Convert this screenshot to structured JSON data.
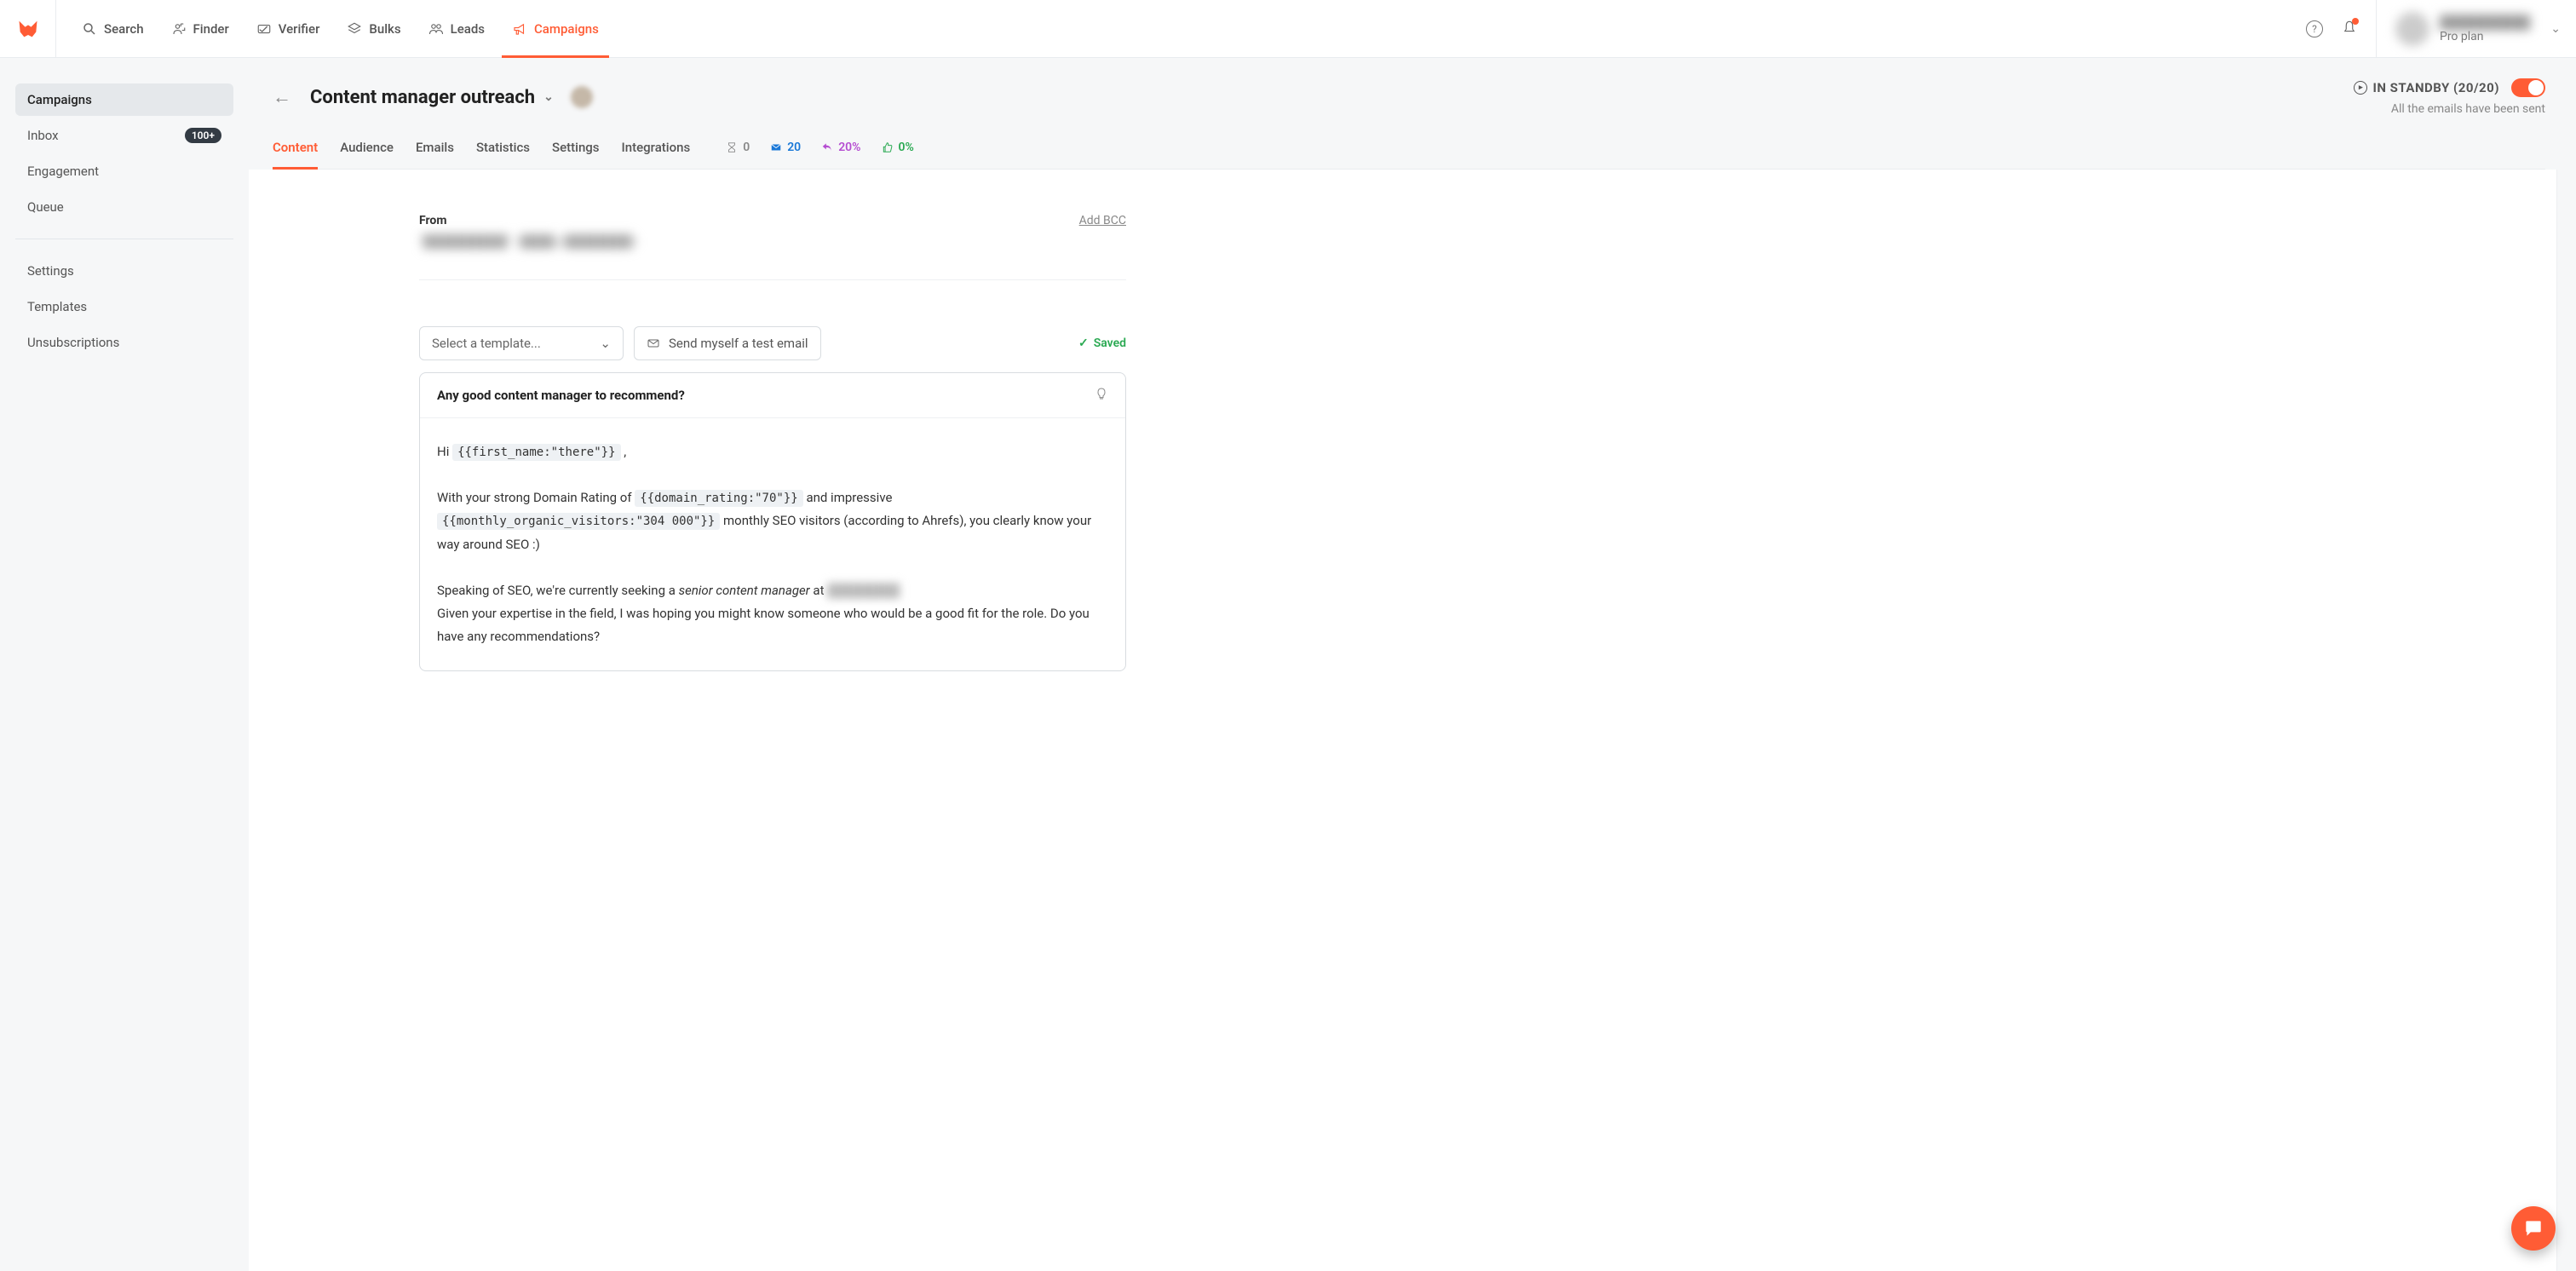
{
  "topnav": {
    "items": [
      {
        "label": "Search"
      },
      {
        "label": "Finder"
      },
      {
        "label": "Verifier"
      },
      {
        "label": "Bulks"
      },
      {
        "label": "Leads"
      },
      {
        "label": "Campaigns"
      }
    ],
    "account": {
      "name": "██████████",
      "plan": "Pro plan"
    }
  },
  "sidebar": {
    "primary": [
      {
        "label": "Campaigns",
        "active": true
      },
      {
        "label": "Inbox",
        "badge": "100+"
      },
      {
        "label": "Engagement"
      },
      {
        "label": "Queue"
      }
    ],
    "secondary": [
      {
        "label": "Settings"
      },
      {
        "label": "Templates"
      },
      {
        "label": "Unsubscriptions"
      }
    ]
  },
  "header": {
    "title": "Content manager outreach",
    "standby": "IN STANDBY (20/20)",
    "standby_sub": "All the emails have been sent"
  },
  "tabs": [
    "Content",
    "Audience",
    "Emails",
    "Statistics",
    "Settings",
    "Integrations"
  ],
  "stats": {
    "pending": "0",
    "sent": "20",
    "replies": "20%",
    "positive": "0%"
  },
  "from": {
    "label": "From",
    "value": "\"██████████\" <████@████████>",
    "add_bcc": "Add BCC"
  },
  "template": {
    "select_placeholder": "Select a template...",
    "test_email": "Send myself a test email",
    "saved": "Saved"
  },
  "email": {
    "subject": "Any good content manager to recommend?",
    "body": {
      "hi": "Hi ",
      "token_first": "{{first_name:\"there\"}}",
      "comma": " ,",
      "p2a": "With your strong Domain Rating of ",
      "token_dr": "{{domain_rating:\"70\"}}",
      "p2b": " and impressive ",
      "token_mv": "{{monthly_organic_visitors:\"304 000\"}}",
      "p2c": " monthly SEO visitors (according to Ahrefs), you clearly know your way around SEO :)",
      "p3a": "Speaking of SEO, we're currently seeking a ",
      "p3em": "senior content manager",
      "p3b": " at ",
      "p3blur": "████████",
      "p4": "Given your expertise in the field, I was hoping you might know someone who would be a good fit for the role. Do you have any recommendations?"
    }
  }
}
